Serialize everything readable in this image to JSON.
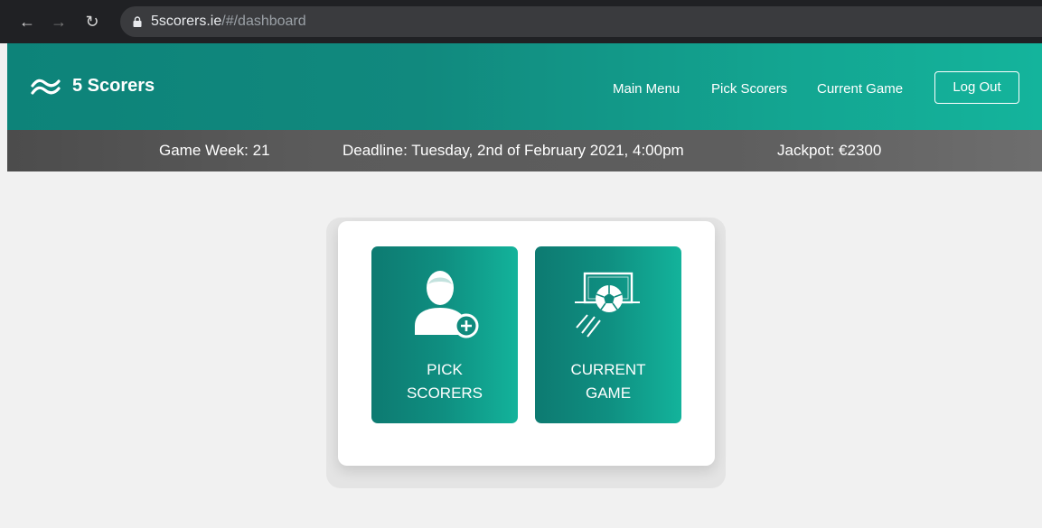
{
  "browser": {
    "back_icon": "arrow-left-icon",
    "forward_icon": "arrow-right-icon",
    "reload_icon": "reload-icon",
    "lock_icon": "lock-icon",
    "url_host": "5scorers.ie",
    "url_path": "/#/dashboard"
  },
  "header": {
    "brand": "5 Scorers",
    "logo_icon": "wave-logo-icon",
    "nav": [
      "Main Menu",
      "Pick Scorers",
      "Current Game"
    ],
    "logout_label": "Log Out"
  },
  "info": {
    "game_week": "Game Week: 21",
    "deadline": "Deadline: Tuesday, 2nd of February 2021, 4:00pm",
    "jackpot": "Jackpot: €2300"
  },
  "tiles": [
    {
      "line1": "PICK",
      "line2": "SCORERS",
      "icon": "user-add-icon"
    },
    {
      "line1": "CURRENT",
      "line2": "GAME",
      "icon": "goal-ball-icon"
    }
  ],
  "colors": {
    "header_start": "#0d8379",
    "header_end": "#14b49c",
    "infobar": "#5b5b5b",
    "tile_start": "#0d7a71",
    "tile_end": "#13b39b"
  }
}
